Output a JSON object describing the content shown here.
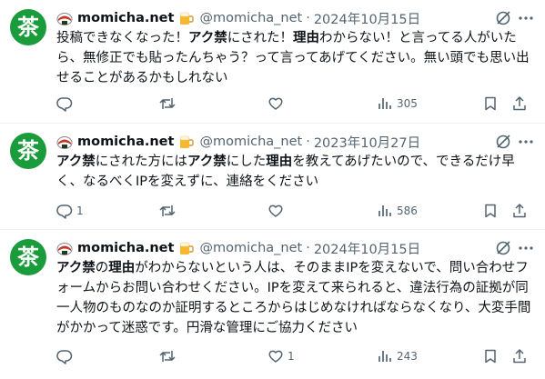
{
  "tweets": [
    {
      "avatar_glyph": "茶",
      "name": "momicha.net",
      "handle": "@momicha_net",
      "separator": "·",
      "date": "2024年10月15日",
      "text": [
        {
          "t": "投稿できなくなった！",
          "b": false
        },
        {
          "t": "アク禁",
          "b": true
        },
        {
          "t": "にされた！",
          "b": false
        },
        {
          "t": "理由",
          "b": true
        },
        {
          "t": "わからない！と言ってる人がいたら、無修正でも貼ったんちゃう？って言ってあげてください。無い頭でも思い出せることがあるかもしれない",
          "b": false
        }
      ],
      "replies": "",
      "reposts": "",
      "likes": "",
      "views": "305"
    },
    {
      "avatar_glyph": "茶",
      "name": "momicha.net",
      "handle": "@momicha_net",
      "separator": "·",
      "date": "2023年10月27日",
      "text": [
        {
          "t": "アク禁",
          "b": true
        },
        {
          "t": "にされた方には",
          "b": false
        },
        {
          "t": "アク禁",
          "b": true
        },
        {
          "t": "にした",
          "b": false
        },
        {
          "t": "理由",
          "b": true
        },
        {
          "t": "を教えてあげたいので、できるだけ早く、なるべくIPを変えずに、連絡をください",
          "b": false
        }
      ],
      "replies": "1",
      "reposts": "",
      "likes": "",
      "views": "586"
    },
    {
      "avatar_glyph": "茶",
      "name": "momicha.net",
      "handle": "@momicha_net",
      "separator": "·",
      "date": "2024年10月15日",
      "text": [
        {
          "t": "アク禁",
          "b": true
        },
        {
          "t": "の",
          "b": false
        },
        {
          "t": "理由",
          "b": true
        },
        {
          "t": "がわからないという人は、そのままIPを変えないで、問い合わせフォームからお問い合わせください。IPを変えて来られると、違法行為の証拠が同一人物のものなのか証明するところからはじめなければならなくなり、大変手間がかかって迷惑です。円滑な管理にご協力ください",
          "b": false
        }
      ],
      "replies": "",
      "reposts": "",
      "likes": "1",
      "views": "243"
    }
  ],
  "colors": {
    "text": "#0f1419",
    "muted": "#536471",
    "avatar_bg": "#1a9b3c",
    "divider": "#eff3f4"
  },
  "icons": [
    "rice-ball-icon",
    "beer-icon",
    "grok-icon",
    "more-icon",
    "reply-icon",
    "repost-icon",
    "like-icon",
    "views-icon",
    "bookmark-icon",
    "share-icon"
  ]
}
